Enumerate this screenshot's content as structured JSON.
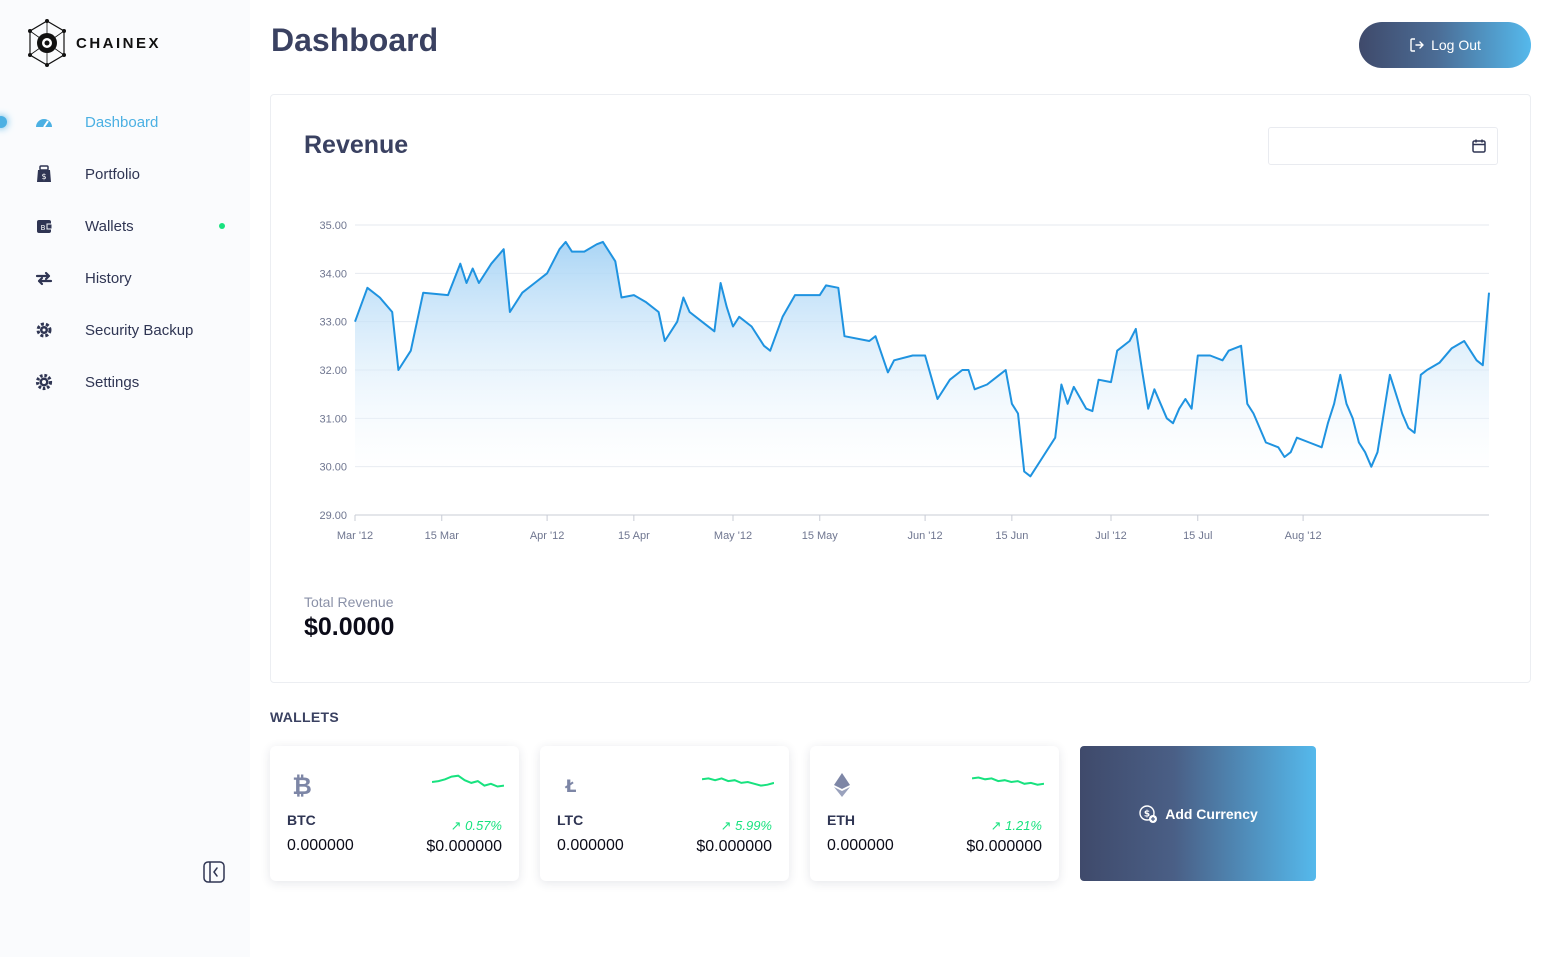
{
  "app": {
    "brand": "CHAINEX",
    "page_title": "Dashboard"
  },
  "sidebar": {
    "items": [
      {
        "label": "Dashboard",
        "icon": "dashboard-icon",
        "active": true
      },
      {
        "label": "Portfolio",
        "icon": "portfolio-icon"
      },
      {
        "label": "Wallets",
        "icon": "wallet-icon",
        "status_dot": true
      },
      {
        "label": "History",
        "icon": "transfer-icon"
      },
      {
        "label": "Security Backup",
        "icon": "security-gear-icon"
      },
      {
        "label": "Settings",
        "icon": "settings-icon"
      }
    ],
    "collapse_icon": "collapse-sidebar-icon"
  },
  "header": {
    "logout_label": "Log Out",
    "logout_icon": "logout-icon"
  },
  "revenue": {
    "title": "Revenue",
    "date_value": "",
    "date_icon": "calendar-icon",
    "total_label": "Total Revenue",
    "total_value": "$0.0000"
  },
  "chart_data": {
    "type": "area",
    "x_ticks": [
      "Mar '12",
      "15 Mar",
      "Apr '12",
      "15 Apr",
      "May '12",
      "15 May",
      "Jun '12",
      "15 Jun",
      "Jul '12",
      "15 Jul",
      "Aug '12"
    ],
    "y_ticks": [
      "35.00",
      "34.00",
      "33.00",
      "32.00",
      "31.00",
      "30.00",
      "29.00"
    ],
    "ylim": [
      29,
      35
    ],
    "grid": true,
    "colors": {
      "line": "#1f93e0",
      "fill_top": "#a6d3f5",
      "fill_bottom": "#ffffff"
    },
    "x_range": [
      "2012-03-01",
      "2012-08-31"
    ],
    "points": [
      [
        "2012-03-01",
        33.0
      ],
      [
        "2012-03-03",
        33.7
      ],
      [
        "2012-03-05",
        33.5
      ],
      [
        "2012-03-07",
        33.2
      ],
      [
        "2012-03-08",
        32.0
      ],
      [
        "2012-03-10",
        32.4
      ],
      [
        "2012-03-12",
        33.6
      ],
      [
        "2012-03-16",
        33.55
      ],
      [
        "2012-03-18",
        34.2
      ],
      [
        "2012-03-19",
        33.8
      ],
      [
        "2012-03-20",
        34.1
      ],
      [
        "2012-03-21",
        33.8
      ],
      [
        "2012-03-23",
        34.2
      ],
      [
        "2012-03-25",
        34.5
      ],
      [
        "2012-03-26",
        33.2
      ],
      [
        "2012-03-28",
        33.6
      ],
      [
        "2012-03-30",
        33.8
      ],
      [
        "2012-04-01",
        34.0
      ],
      [
        "2012-04-03",
        34.5
      ],
      [
        "2012-04-04",
        34.65
      ],
      [
        "2012-04-05",
        34.45
      ],
      [
        "2012-04-07",
        34.45
      ],
      [
        "2012-04-09",
        34.6
      ],
      [
        "2012-04-10",
        34.65
      ],
      [
        "2012-04-12",
        34.25
      ],
      [
        "2012-04-13",
        33.5
      ],
      [
        "2012-04-15",
        33.55
      ],
      [
        "2012-04-17",
        33.4
      ],
      [
        "2012-04-19",
        33.2
      ],
      [
        "2012-04-20",
        32.6
      ],
      [
        "2012-04-22",
        33.0
      ],
      [
        "2012-04-23",
        33.5
      ],
      [
        "2012-04-24",
        33.2
      ],
      [
        "2012-04-26",
        33.0
      ],
      [
        "2012-04-28",
        32.8
      ],
      [
        "2012-04-29",
        33.8
      ],
      [
        "2012-04-30",
        33.3
      ],
      [
        "2012-05-01",
        32.9
      ],
      [
        "2012-05-02",
        33.1
      ],
      [
        "2012-05-04",
        32.9
      ],
      [
        "2012-05-06",
        32.5
      ],
      [
        "2012-05-07",
        32.4
      ],
      [
        "2012-05-09",
        33.1
      ],
      [
        "2012-05-11",
        33.55
      ],
      [
        "2012-05-15",
        33.55
      ],
      [
        "2012-05-16",
        33.75
      ],
      [
        "2012-05-18",
        33.7
      ],
      [
        "2012-05-19",
        32.7
      ],
      [
        "2012-05-23",
        32.6
      ],
      [
        "2012-05-24",
        32.7
      ],
      [
        "2012-05-26",
        31.95
      ],
      [
        "2012-05-27",
        32.2
      ],
      [
        "2012-05-30",
        32.3
      ],
      [
        "2012-06-01",
        32.3
      ],
      [
        "2012-06-03",
        31.4
      ],
      [
        "2012-06-05",
        31.8
      ],
      [
        "2012-06-07",
        32.0
      ],
      [
        "2012-06-08",
        32.0
      ],
      [
        "2012-06-09",
        31.6
      ],
      [
        "2012-06-11",
        31.7
      ],
      [
        "2012-06-13",
        31.9
      ],
      [
        "2012-06-14",
        32.0
      ],
      [
        "2012-06-15",
        31.3
      ],
      [
        "2012-06-16",
        31.1
      ],
      [
        "2012-06-17",
        29.9
      ],
      [
        "2012-06-18",
        29.8
      ],
      [
        "2012-06-20",
        30.2
      ],
      [
        "2012-06-21",
        30.4
      ],
      [
        "2012-06-22",
        30.6
      ],
      [
        "2012-06-23",
        31.7
      ],
      [
        "2012-06-24",
        31.3
      ],
      [
        "2012-06-25",
        31.65
      ],
      [
        "2012-06-27",
        31.2
      ],
      [
        "2012-06-28",
        31.15
      ],
      [
        "2012-06-29",
        31.8
      ],
      [
        "2012-07-01",
        31.75
      ],
      [
        "2012-07-02",
        32.4
      ],
      [
        "2012-07-04",
        32.6
      ],
      [
        "2012-07-05",
        32.85
      ],
      [
        "2012-07-06",
        32.0
      ],
      [
        "2012-07-07",
        31.2
      ],
      [
        "2012-07-08",
        31.6
      ],
      [
        "2012-07-09",
        31.3
      ],
      [
        "2012-07-10",
        31.0
      ],
      [
        "2012-07-11",
        30.9
      ],
      [
        "2012-07-12",
        31.2
      ],
      [
        "2012-07-13",
        31.4
      ],
      [
        "2012-07-14",
        31.2
      ],
      [
        "2012-07-15",
        32.3
      ],
      [
        "2012-07-17",
        32.3
      ],
      [
        "2012-07-19",
        32.2
      ],
      [
        "2012-07-20",
        32.4
      ],
      [
        "2012-07-22",
        32.5
      ],
      [
        "2012-07-23",
        31.3
      ],
      [
        "2012-07-24",
        31.1
      ],
      [
        "2012-07-26",
        30.5
      ],
      [
        "2012-07-28",
        30.4
      ],
      [
        "2012-07-29",
        30.2
      ],
      [
        "2012-07-30",
        30.3
      ],
      [
        "2012-07-31",
        30.6
      ],
      [
        "2012-08-02",
        30.5
      ],
      [
        "2012-08-04",
        30.4
      ],
      [
        "2012-08-05",
        30.9
      ],
      [
        "2012-08-06",
        31.3
      ],
      [
        "2012-08-07",
        31.9
      ],
      [
        "2012-08-08",
        31.3
      ],
      [
        "2012-08-09",
        31.0
      ],
      [
        "2012-08-10",
        30.5
      ],
      [
        "2012-08-11",
        30.3
      ],
      [
        "2012-08-12",
        30.0
      ],
      [
        "2012-08-13",
        30.3
      ],
      [
        "2012-08-14",
        31.1
      ],
      [
        "2012-08-15",
        31.9
      ],
      [
        "2012-08-17",
        31.1
      ],
      [
        "2012-08-18",
        30.8
      ],
      [
        "2012-08-19",
        30.7
      ],
      [
        "2012-08-20",
        31.9
      ],
      [
        "2012-08-21",
        32.0
      ],
      [
        "2012-08-23",
        32.15
      ],
      [
        "2012-08-25",
        32.45
      ],
      [
        "2012-08-27",
        32.6
      ],
      [
        "2012-08-28",
        32.4
      ],
      [
        "2012-08-29",
        32.2
      ],
      [
        "2012-08-30",
        32.1
      ],
      [
        "2012-08-31",
        33.6
      ]
    ]
  },
  "wallets": {
    "heading": "WALLETS",
    "items": [
      {
        "symbol": "BTC",
        "icon": "bitcoin-icon",
        "change": "0.57%",
        "amount": "0.000000",
        "value": "$0.000000",
        "trend_icon": "arrow-up-right-icon",
        "spark": [
          0.5,
          0.45,
          0.35,
          0.2,
          0.15,
          0.4,
          0.55,
          0.45,
          0.7,
          0.6,
          0.75,
          0.7
        ]
      },
      {
        "symbol": "LTC",
        "icon": "litecoin-icon",
        "change": "5.99%",
        "amount": "0.000000",
        "value": "$0.000000",
        "trend_icon": "arrow-up-right-icon",
        "spark": [
          0.35,
          0.3,
          0.4,
          0.3,
          0.45,
          0.4,
          0.55,
          0.5,
          0.6,
          0.7,
          0.65,
          0.55
        ]
      },
      {
        "symbol": "ETH",
        "icon": "ethereum-icon",
        "change": "1.21%",
        "amount": "0.000000",
        "value": "$0.000000",
        "trend_icon": "arrow-up-right-icon",
        "spark": [
          0.3,
          0.25,
          0.35,
          0.3,
          0.45,
          0.4,
          0.5,
          0.45,
          0.6,
          0.55,
          0.65,
          0.6
        ]
      }
    ],
    "add_label": "Add Currency",
    "add_icon": "add-currency-icon",
    "spark_color": "#18e27f"
  }
}
